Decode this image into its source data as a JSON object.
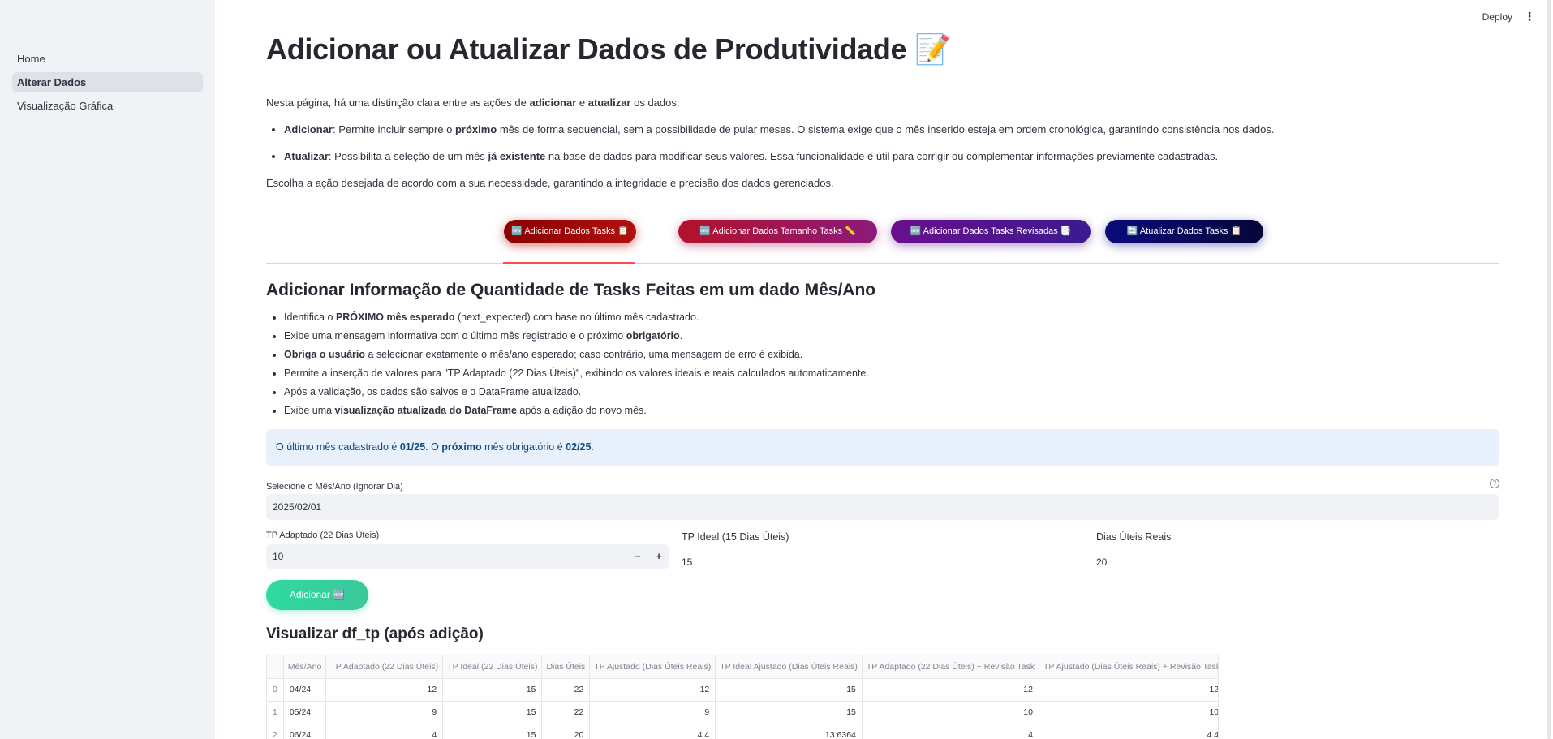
{
  "sidebar": {
    "items": [
      {
        "label": "Home"
      },
      {
        "label": "Alterar Dados"
      },
      {
        "label": "Visualização Gráfica"
      }
    ]
  },
  "topbar": {
    "deploy_label": "Deploy",
    "menu_glyph": "⋮"
  },
  "page": {
    "title": "Adicionar ou Atualizar Dados de Produtividade 📝",
    "intro_pre": "Nesta página, há uma distinção clara entre as ações de ",
    "intro_b1": "adicionar",
    "intro_mid": " e ",
    "intro_b2": "atualizar",
    "intro_post": " os dados:",
    "bullet1_b": "Adicionar",
    "bullet1_pre": ": Permite incluir sempre o ",
    "bullet1_b2": "próximo",
    "bullet1_post": " mês de forma sequencial, sem a possibilidade de pular meses. O sistema exige que o mês inserido esteja em ordem cronológica, garantindo consistência nos dados.",
    "bullet2_b": "Atualizar",
    "bullet2_pre": ": Possibilita a seleção de um mês ",
    "bullet2_b2": "já existente",
    "bullet2_post": " na base de dados para modificar seus valores. Essa funcionalidade é útil para corrigir ou complementar informações previamente cadastradas.",
    "closing": "Escolha a ação desejada de acordo com a sua necessidade, garantindo a integridade e precisão dos dados gerenciados."
  },
  "tabs": [
    {
      "label": "🆕 Adicionar Dados Tasks 📋",
      "color": "#8b0000"
    },
    {
      "label": "🆕 Adicionar Dados Tamanho Tasks 📏",
      "color": "#b3122a"
    },
    {
      "label": "🆕 Adicionar Dados Tasks Revisadas 📑",
      "color": "#6a0f8c"
    },
    {
      "label": "🔄 Atualizar Dados Tasks 📋",
      "color": "#0b0b7a"
    }
  ],
  "section": {
    "title": "Adicionar Informação de Quantidade de Tasks Feitas em um dado Mês/Ano",
    "f1_pre": "Identifica o ",
    "f1_b": "PRÓXIMO mês esperado",
    "f1_post": " (next_expected) com base no último mês cadastrado.",
    "f2_pre": "Exibe uma mensagem informativa com o último mês registrado e o próximo ",
    "f2_b": "obrigatório",
    "f2_post": ".",
    "f3_b": "Obriga o usuário",
    "f3_post": " a selecionar exatamente o mês/ano esperado; caso contrário, uma mensagem de erro é exibida.",
    "f4": "Permite a inserção de valores para \"TP Adaptado (22 Dias Úteis)\", exibindo os valores ideais e reais calculados automaticamente.",
    "f5": "Após a validação, os dados são salvos e o DataFrame atualizado.",
    "f6_pre": "Exibe uma ",
    "f6_b": "visualização atualizada do DataFrame",
    "f6_post": " após a adição do novo mês."
  },
  "info": {
    "pre": "O último mês cadastrado é ",
    "last": "01/25",
    "mid": ". O ",
    "prox": "próximo",
    "mid2": " mês obrigatório é ",
    "next": "02/25",
    "end": "."
  },
  "form": {
    "date_label": "Selecione o Mês/Ano (Ignorar Dia)",
    "date_value": "2025/02/01",
    "tp_label": "TP Adaptado (22 Dias Úteis)",
    "tp_value": "10",
    "ideal_label": "TP Ideal (15 Dias Úteis)",
    "ideal_value": "15",
    "dias_label": "Dias Úteis Reais",
    "dias_value": "20",
    "add_label": "Adicionar 🆕"
  },
  "table": {
    "title": "Visualizar df_tp (após adição)",
    "columns": [
      "",
      "Mês/Ano",
      "TP Adaptado (22 Dias Úteis)",
      "TP Ideal (22 Dias Úteis)",
      "Dias Úteis",
      "TP Ajustado (Dias Úteis Reais)",
      "TP Ideal Ajustado (Dias Úteis Reais)",
      "TP Adaptado (22 Dias Úteis) + Revisão Task",
      "TP Ajustado (Dias Úteis Reais) + Revisão Task"
    ],
    "rows": [
      [
        "0",
        "04/24",
        "12",
        "15",
        "22",
        "12",
        "15",
        "12",
        "12"
      ],
      [
        "1",
        "05/24",
        "9",
        "15",
        "22",
        "9",
        "15",
        "10",
        "10"
      ],
      [
        "2",
        "06/24",
        "4",
        "15",
        "20",
        "4.4",
        "13.6364",
        "4",
        "4.4"
      ]
    ]
  }
}
